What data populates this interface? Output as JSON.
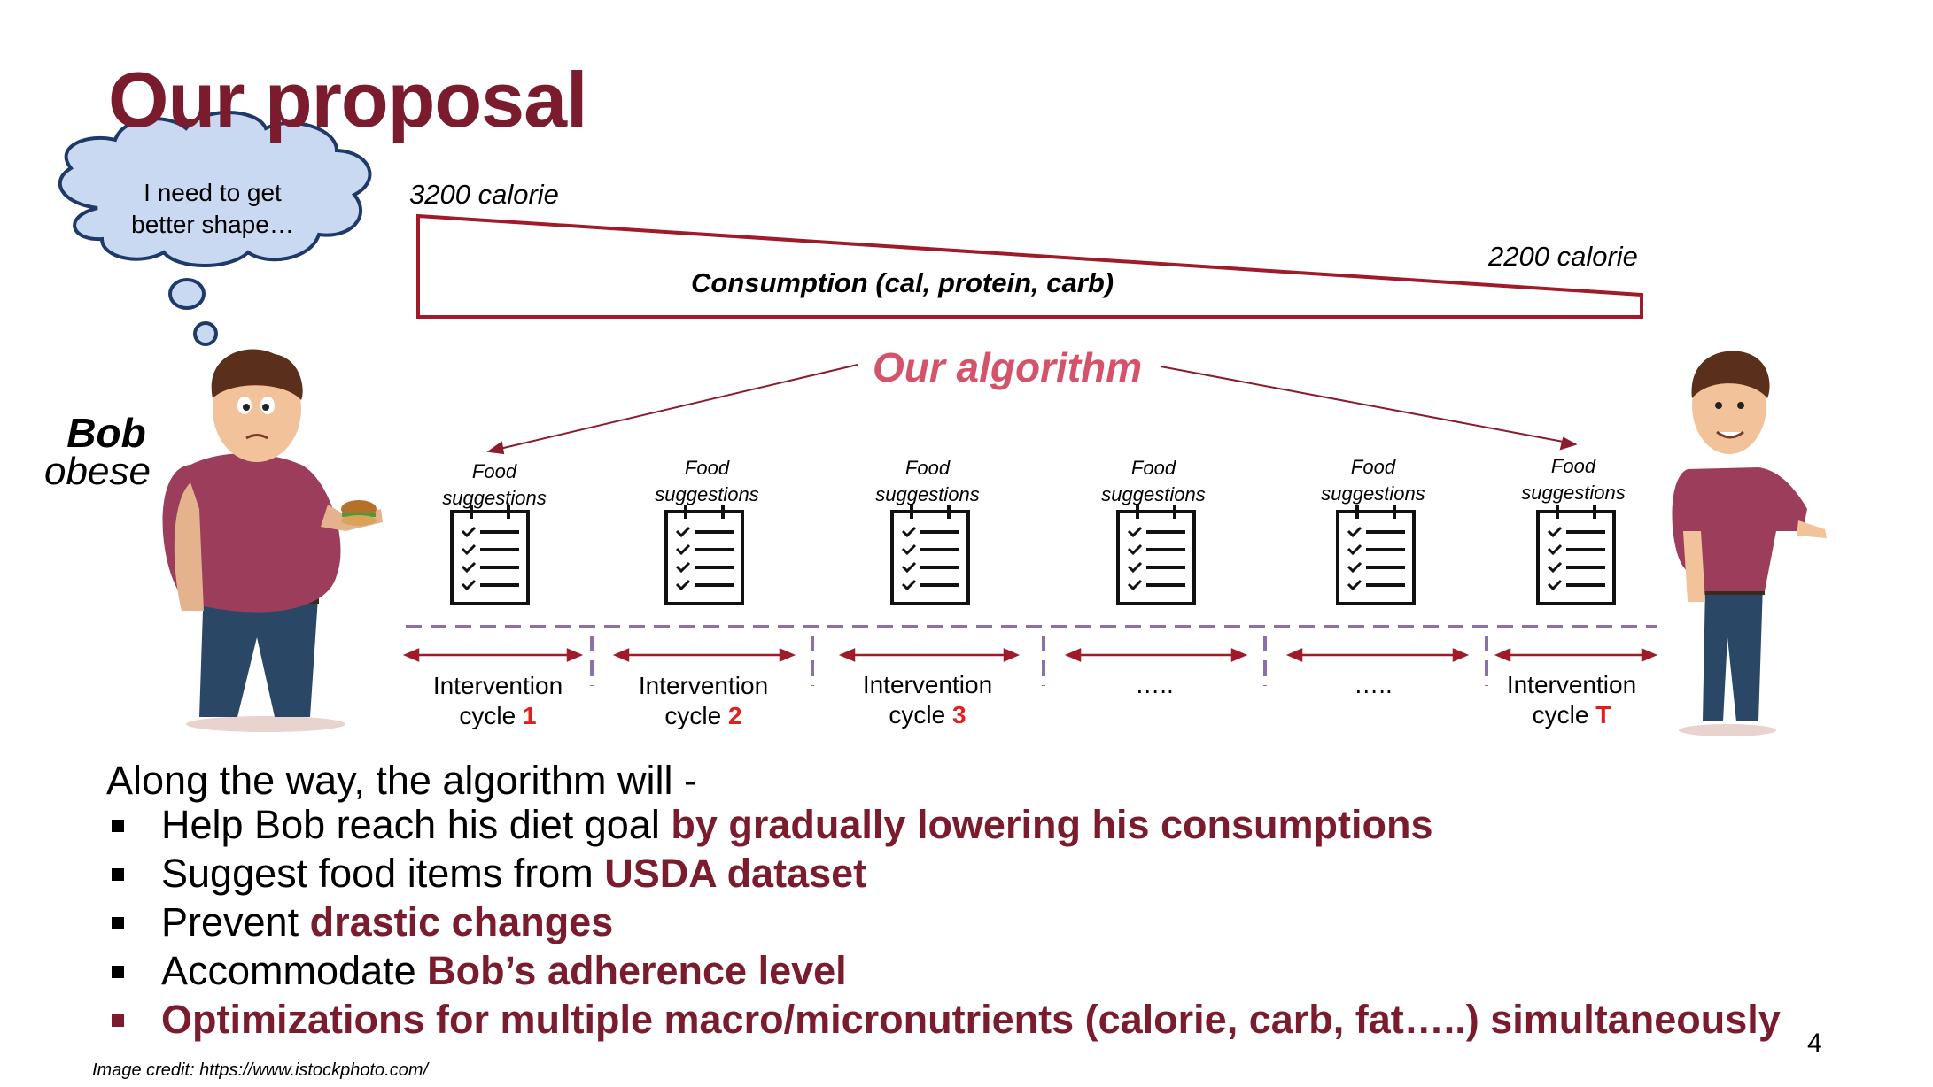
{
  "slide": {
    "title": "Our proposal",
    "thought_bubble": [
      "I need to get",
      "better shape…"
    ],
    "bob_name": "Bob",
    "bob_state": "obese",
    "calorie_start": "3200 calorie",
    "calorie_end": "2200 calorie",
    "consumption_label": "Consumption (cal, protein, carb)",
    "algorithm_label": "Our algorithm",
    "food_suggestions": [
      [
        "Food",
        "suggestions"
      ],
      [
        "Food",
        "suggestions"
      ],
      [
        "Food",
        "suggestions"
      ],
      [
        "Food",
        "suggestions"
      ],
      [
        "Food",
        "suggestions"
      ],
      [
        "Food",
        "suggestions"
      ]
    ],
    "cycles": [
      {
        "text": "Intervention",
        "prefix": "cycle ",
        "num": "1"
      },
      {
        "text": "Intervention",
        "prefix": "cycle ",
        "num": "2"
      },
      {
        "text": "Intervention",
        "prefix": "cycle ",
        "num": "3"
      },
      {
        "dots": "….."
      },
      {
        "dots": "….."
      },
      {
        "text": "Intervention",
        "prefix": "cycle ",
        "num": "T"
      }
    ],
    "intro": "Along the way, the algorithm will -",
    "bullets": [
      {
        "plain": "Help Bob reach his diet goal ",
        "bold": "by gradually lowering his consumptions"
      },
      {
        "plain": "Suggest food items from ",
        "bold": "USDA dataset"
      },
      {
        "plain": "Prevent ",
        "bold": "drastic changes"
      },
      {
        "plain": "Accommodate ",
        "bold": "Bob’s adherence level"
      },
      {
        "plain": "",
        "bold": "Optimizations for multiple macro/micronutrients (calorie, carb, fat…..) simultaneously"
      }
    ],
    "page_number": "4",
    "credit": "Image credit: https://www.istockphoto.com/"
  },
  "colors": {
    "title": "#7b1c2e",
    "algorithm": "#d4536b",
    "accent_red": "#e02020",
    "dashed_line": "#8a6fa8",
    "bubble_fill": "#c9d9f2",
    "bubble_stroke": "#1f3a68"
  },
  "icons": [
    "thought-bubble-icon",
    "obese-bob-illustration",
    "fit-bob-illustration",
    "checklist-icon",
    "double-arrow-icon"
  ]
}
